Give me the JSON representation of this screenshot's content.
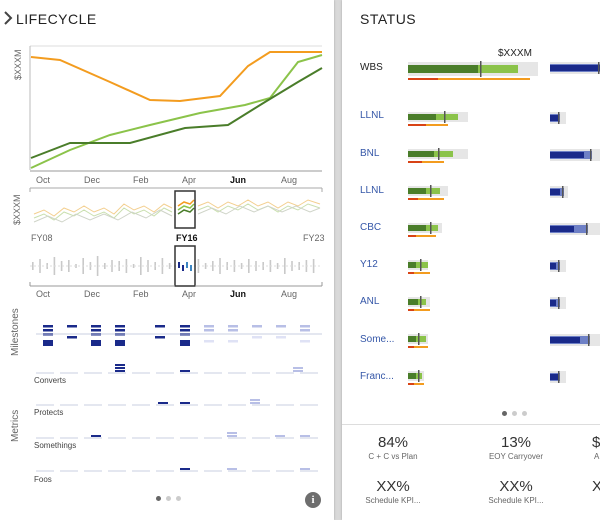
{
  "lifecycle": {
    "title": "LIFECYCLE",
    "y_label": "$XXXM",
    "months": [
      "Oct",
      "Dec",
      "Feb",
      "Apr",
      "Jun",
      "Aug"
    ],
    "selected_month": "Jun",
    "fy_start": "FY08",
    "fy_selected": "FY16",
    "fy_end": "FY23",
    "side_label_milestones": "Milestones",
    "side_label_metrics": "Metrics",
    "metric_rows": [
      "Converts",
      "Protects",
      "Somethings",
      "Foos"
    ],
    "colors": {
      "orange": "#f39c1f",
      "green_light": "#8bc34a",
      "green_dark": "#4a7d2a",
      "navy": "#1a2a8a"
    }
  },
  "status": {
    "title": "STATUS",
    "bullet_header": "WBS",
    "value_header": "$XXXM",
    "rows": [
      "LLNL",
      "BNL",
      "LLNL",
      "CBC",
      "Y12",
      "ANL",
      "Some...",
      "Franc..."
    ],
    "kpis": [
      {
        "value": "84%",
        "label": "C + C vs Plan"
      },
      {
        "value": "13%",
        "label": "EOY Carryover"
      },
      {
        "value": "XX%",
        "label": "Schedule KPI..."
      },
      {
        "value": "XX%",
        "label": "Schedule KPI..."
      }
    ],
    "partial_kpis": [
      "$",
      "A",
      "X"
    ]
  },
  "info_icon": "i"
}
